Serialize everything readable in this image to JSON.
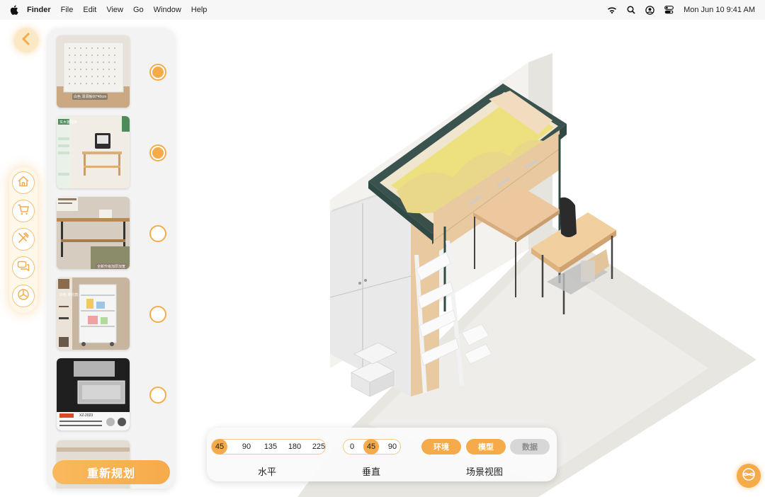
{
  "menubar": {
    "app_name": "Finder",
    "items": [
      "File",
      "Edit",
      "View",
      "Go",
      "Window",
      "Help"
    ],
    "datetime": "Mon Jun 10  9:41 AM"
  },
  "products": [
    {
      "tag": "白色 洞洞板60*40cm",
      "selected": true
    },
    {
      "tag": "实木置物架",
      "selected": true
    },
    {
      "tag": "全新升级加厚加宽",
      "selected": false
    },
    {
      "tag": "白色·简约款",
      "selected": false
    },
    {
      "tag": "XZ-2023",
      "selected": false
    }
  ],
  "replan_label": "重新规划",
  "horizontal": {
    "label": "水平",
    "options": [
      "45",
      "90",
      "135",
      "180",
      "225"
    ],
    "selected": "45"
  },
  "vertical": {
    "label": "垂直",
    "options": [
      "0",
      "45",
      "90"
    ],
    "selected": "45"
  },
  "scene_view": {
    "label": "场景视图",
    "modes": [
      "环境",
      "模型",
      "数据"
    ]
  },
  "colors": {
    "accent": "#f6ab4a",
    "panel": "#f3f3f3"
  }
}
